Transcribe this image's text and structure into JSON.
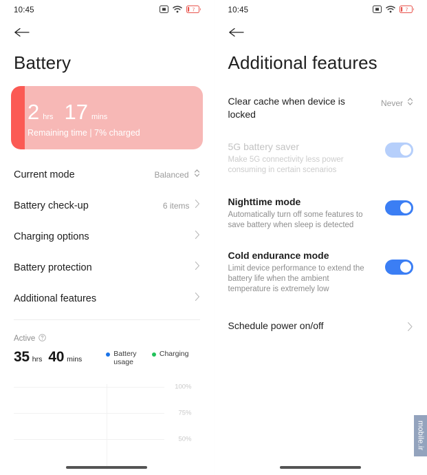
{
  "status_bar": {
    "time": "10:45",
    "icons": [
      "vibrate-icon",
      "wifi-icon",
      "battery-icon"
    ],
    "battery_level_text": "7"
  },
  "colors": {
    "accent_blue": "#3b7ef4",
    "toggle_disabled_blue": "#b6cffb",
    "battery_card_bg": "#f7b8b6",
    "battery_card_fill": "#fb5a54",
    "legend_battery": "#1a73e8",
    "legend_charging": "#21c25a",
    "text_primary": "#1d1d1d",
    "text_secondary": "#8d8d8d",
    "watermark_bg": "#93a3bd"
  },
  "left_panel": {
    "back_label": "Back",
    "title": "Battery",
    "battery_card": {
      "hours": "2",
      "hours_unit": "hrs",
      "minutes": "17",
      "minutes_unit": "mins",
      "subtitle": "Remaining time | 7% charged",
      "charge_percent": 7
    },
    "rows": [
      {
        "label": "Current mode",
        "value": "Balanced",
        "control": "stepper-chevron"
      },
      {
        "label": "Battery check-up",
        "value": "6 items",
        "control": "chevron"
      },
      {
        "label": "Charging options",
        "value": "",
        "control": "chevron"
      },
      {
        "label": "Battery protection",
        "value": "",
        "control": "chevron"
      },
      {
        "label": "Additional features",
        "value": "",
        "control": "chevron"
      }
    ],
    "active_section": {
      "label": "Active",
      "help_icon": "question-circle-icon",
      "hours": "35",
      "hours_unit": "hrs",
      "minutes": "40",
      "minutes_unit": "mins",
      "legend": [
        {
          "label": "Battery usage",
          "color": "#1a73e8"
        },
        {
          "label": "Charging",
          "color": "#21c25a"
        }
      ]
    },
    "chart_data": {
      "type": "line",
      "title": "",
      "xlabel": "",
      "ylabel": "",
      "ylim": [
        50,
        100
      ],
      "yticks": [
        100,
        75,
        50
      ],
      "ytick_labels": [
        "100%",
        "75%",
        "50%"
      ],
      "grid": true,
      "legend_position": "top-right",
      "series": [
        {
          "name": "Battery usage",
          "color": "#1a73e8",
          "values": []
        },
        {
          "name": "Charging",
          "color": "#21c25a",
          "values": []
        }
      ],
      "x": []
    }
  },
  "right_panel": {
    "back_label": "Back",
    "title": "Additional features",
    "rows": [
      {
        "title": "Clear cache when device is locked",
        "desc": "",
        "value": "Never",
        "control": "stepper-chevron",
        "disabled": false,
        "bold": false
      },
      {
        "title": "5G battery saver",
        "desc": "Make 5G connectivity less power consuming in certain scenarios",
        "value": "",
        "control": "toggle",
        "toggle_state": "on-disabled",
        "disabled": true,
        "bold": false
      },
      {
        "title": "Nighttime mode",
        "desc": "Automatically turn off some features to save battery when sleep is detected",
        "value": "",
        "control": "toggle",
        "toggle_state": "on",
        "disabled": false,
        "bold": true
      },
      {
        "title": "Cold endurance mode",
        "desc": "Limit device performance to extend the battery life when the ambient temperature is extremely low",
        "value": "",
        "control": "toggle",
        "toggle_state": "on",
        "disabled": false,
        "bold": true
      },
      {
        "title": "Schedule power on/off",
        "desc": "",
        "value": "",
        "control": "chevron",
        "disabled": false,
        "bold": false
      }
    ]
  },
  "watermark": {
    "text": "mobile.ir"
  }
}
